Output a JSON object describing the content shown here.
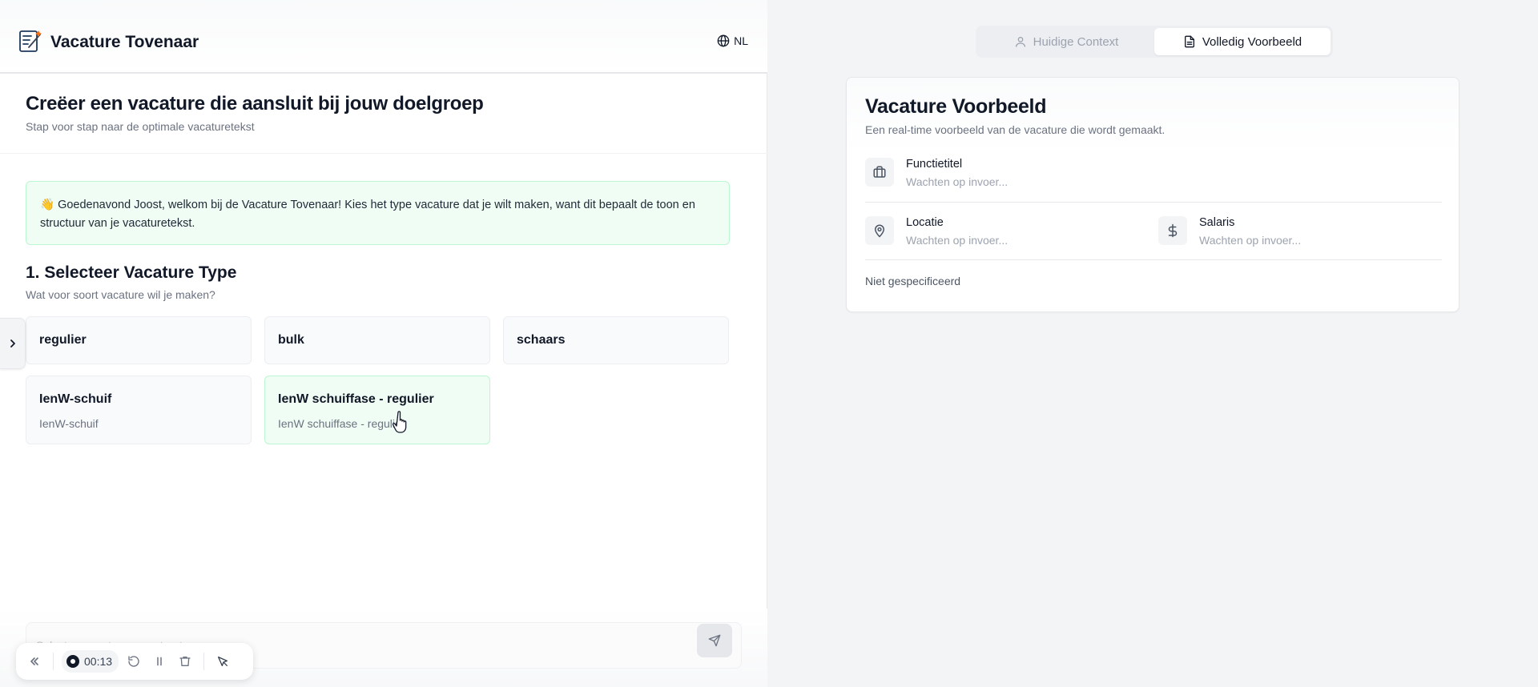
{
  "app": {
    "title": "Vacature Tovenaar",
    "language": "NL"
  },
  "page": {
    "title": "Creëer een vacature die aansluit bij jouw doelgroep",
    "subtitle": "Stap voor stap naar de optimale vacaturetekst"
  },
  "welcome": {
    "emoji": "👋",
    "text": "Goedenavond Joost, welkom bij de Vacature Tovenaar! Kies het type vacature dat je wilt maken, want dit bepaalt de toon en structuur van je vacaturetekst."
  },
  "step": {
    "title": "1. Selecteer Vacature Type",
    "subtitle": "Wat voor soort vacature wil je maken?"
  },
  "vacancy_types": [
    {
      "title": "regulier",
      "subtitle": ""
    },
    {
      "title": "bulk",
      "subtitle": ""
    },
    {
      "title": "schaars",
      "subtitle": ""
    },
    {
      "title": "IenW-schuif",
      "subtitle": "IenW-schuif"
    },
    {
      "title": "IenW schuiffase - regulier",
      "subtitle": "IenW schuiffase - regulier",
      "hovered": true
    }
  ],
  "chat": {
    "placeholder": "Selecteer eerst een vacaturetype"
  },
  "recorder": {
    "time": "00:13"
  },
  "tabs": [
    {
      "label": "Huidige Context",
      "icon": "user-icon",
      "active": false
    },
    {
      "label": "Volledig Voorbeeld",
      "icon": "document-icon",
      "active": true
    }
  ],
  "preview": {
    "title": "Vacature Voorbeeld",
    "subtitle": "Een real-time voorbeeld van de vacature die wordt gemaakt.",
    "fields": {
      "functietitel": {
        "label": "Functietitel",
        "value": "Wachten op invoer...",
        "icon": "briefcase-icon"
      },
      "locatie": {
        "label": "Locatie",
        "value": "Wachten op invoer...",
        "icon": "map-pin-icon"
      },
      "salaris": {
        "label": "Salaris",
        "value": "Wachten op invoer...",
        "icon": "dollar-icon"
      }
    },
    "footer": "Niet gespecificeerd"
  },
  "colors": {
    "accent_green_bg": "#f0fdf4",
    "accent_green_border": "#bbf7d0",
    "muted_text": "#6b7280"
  }
}
